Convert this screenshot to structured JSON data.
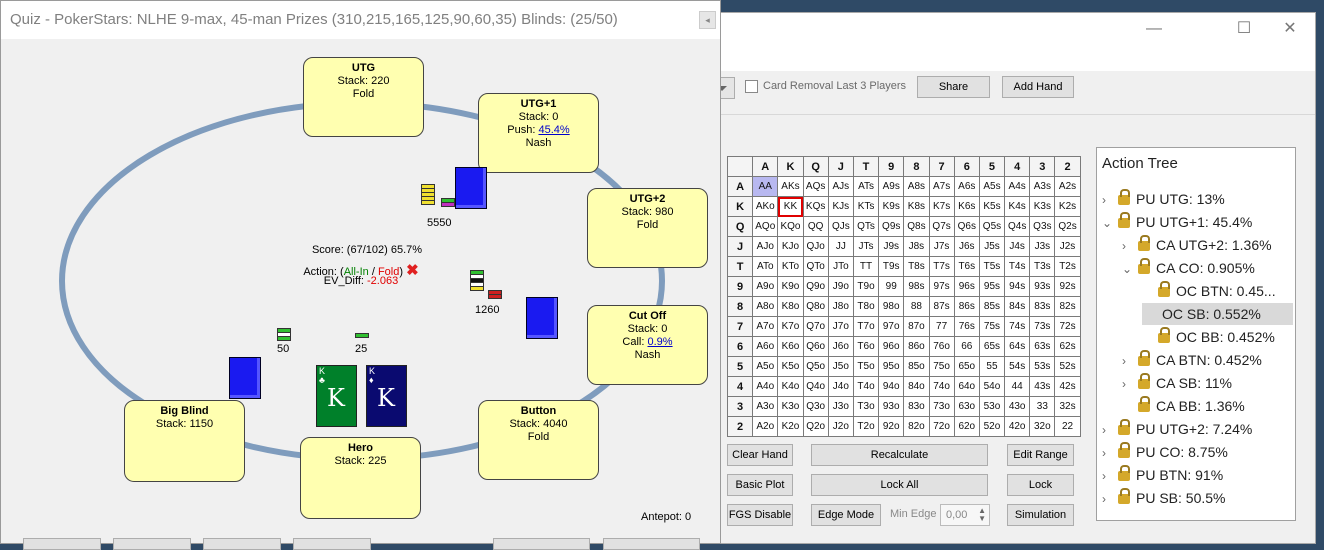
{
  "quiz": {
    "title": "Quiz - PokerStars: NLHE 9-max, 45-man Prizes (310,215,165,125,90,60,35) Blinds: (25/50)",
    "seats": {
      "utg": {
        "name": "UTG",
        "stack": "Stack: 220",
        "action": "Fold"
      },
      "utg1": {
        "name": "UTG+1",
        "stack": "Stack: 0",
        "action_prefix": "Push: ",
        "action_link": "45.4%",
        "action2": "Nash"
      },
      "utg2": {
        "name": "UTG+2",
        "stack": "Stack: 980",
        "action": "Fold"
      },
      "cutoff": {
        "name": "Cut Off",
        "stack": "Stack: 0",
        "action_prefix": "Call: ",
        "action_link": "0.9%",
        "action2": "Nash"
      },
      "button": {
        "name": "Button",
        "stack": "Stack: 4040",
        "action": "Fold"
      },
      "hero": {
        "name": "Hero",
        "stack": "Stack: 225"
      },
      "bigblind": {
        "name": "Big Blind",
        "stack": "Stack: 1150"
      }
    },
    "chips": {
      "utg1": "5550",
      "cutoff": "1260",
      "bb": "50",
      "sb": "25"
    },
    "score": "Score: (67/102) 65.7%",
    "action_prefix": "Action: (",
    "action_allin": "All-In",
    "action_sep": " / ",
    "action_fold": "Fold",
    "action_suffix": ")",
    "ev_label": "EV_Diff: ",
    "ev_value": "-2.063",
    "antepot": "Antepot: 0",
    "hero_cards": [
      {
        "rank": "K",
        "suit": "♣",
        "color": "#00802a"
      },
      {
        "rank": "K",
        "suit": "♦",
        "color": "#0a0a70"
      }
    ]
  },
  "toolbar": {
    "card_removal": "Card Removal Last 3 Players",
    "share": "Share",
    "add_hand": "Add Hand"
  },
  "matrix": {
    "ranks": [
      "A",
      "K",
      "Q",
      "J",
      "T",
      "9",
      "8",
      "7",
      "6",
      "5",
      "4",
      "3",
      "2"
    ],
    "selected": "KK"
  },
  "buttons": {
    "clear_hand": "Clear Hand",
    "recalculate": "Recalculate",
    "edit_range": "Edit Range",
    "basic_plot": "Basic Plot",
    "lock_all": "Lock All",
    "lock": "Lock",
    "fgs_disable": "FGS Disable",
    "edge_mode": "Edge Mode",
    "min_edge_label": "Min Edge",
    "min_edge_value": "0,00",
    "simulation": "Simulation"
  },
  "action_tree": {
    "title": "Action Tree",
    "nodes": [
      {
        "label": "PU UTG: 13%",
        "level": 0,
        "arrow": "›",
        "lock": true
      },
      {
        "label": "PU UTG+1: 45.4%",
        "level": 0,
        "arrow": "⌄",
        "lock": true
      },
      {
        "label": "CA UTG+2: 1.36%",
        "level": 1,
        "arrow": "›",
        "lock": true
      },
      {
        "label": "CA CO: 0.905%",
        "level": 1,
        "arrow": "⌄",
        "lock": true
      },
      {
        "label": "OC BTN: 0.45...",
        "level": 2,
        "arrow": "",
        "lock": true
      },
      {
        "label": "OC SB: 0.552%",
        "level": 2,
        "arrow": "",
        "lock": false,
        "highlight": true
      },
      {
        "label": "OC BB: 0.452%",
        "level": 2,
        "arrow": "",
        "lock": true
      },
      {
        "label": "CA BTN: 0.452%",
        "level": 1,
        "arrow": "›",
        "lock": true
      },
      {
        "label": "CA SB: 11%",
        "level": 1,
        "arrow": "›",
        "lock": true
      },
      {
        "label": "CA BB: 1.36%",
        "level": 1,
        "arrow": "",
        "lock": true
      },
      {
        "label": "PU UTG+2: 7.24%",
        "level": 0,
        "arrow": "›",
        "lock": true
      },
      {
        "label": "PU CO: 8.75%",
        "level": 0,
        "arrow": "›",
        "lock": true
      },
      {
        "label": "PU BTN: 91%",
        "level": 0,
        "arrow": "›",
        "lock": true
      },
      {
        "label": "PU SB: 50.5%",
        "level": 0,
        "arrow": "›",
        "lock": true
      }
    ]
  },
  "window_controls": {
    "minimize": "—",
    "maximize": "☐",
    "close": "✕"
  }
}
